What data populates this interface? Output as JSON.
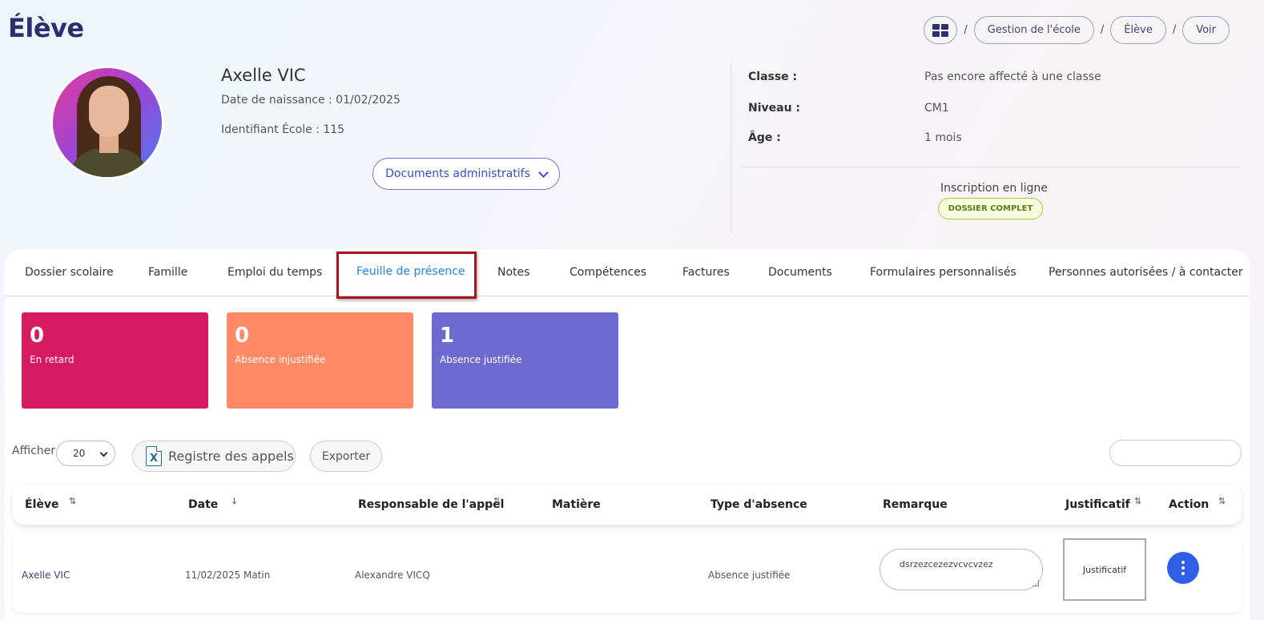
{
  "page": {
    "title": "Élève"
  },
  "breadcrumb": {
    "separator": "/",
    "items": [
      {
        "label": "Gestion de l'école"
      },
      {
        "label": "Élève"
      },
      {
        "label": "Voir"
      }
    ]
  },
  "student": {
    "name": "Axelle VIC",
    "dob": "Date de naissance : 01/02/2025",
    "school_id": "Identifiant École : 115",
    "docs_button": "Documents administratifs"
  },
  "info": {
    "classe_label": "Classe :",
    "classe_value": "Pas encore affecté à une classe",
    "niveau_label": "Niveau :",
    "niveau_value": "CM1",
    "age_label": "Âge :",
    "age_value": "1 mois",
    "online_label": "Inscription en ligne",
    "status_badge": "DOSSIER COMPLET"
  },
  "tabs": [
    {
      "label": "Dossier scolaire"
    },
    {
      "label": "Famille"
    },
    {
      "label": "Emploi du temps"
    },
    {
      "label": "Feuille de présence",
      "active": true
    },
    {
      "label": "Notes"
    },
    {
      "label": "Compétences"
    },
    {
      "label": "Factures"
    },
    {
      "label": "Documents"
    },
    {
      "label": "Formulaires personnalisés"
    },
    {
      "label": "Personnes autorisées / à contacter"
    }
  ],
  "stats": [
    {
      "value": "0",
      "label": "En retard",
      "color": "#d81b60"
    },
    {
      "value": "0",
      "label": "Absence injustifiée",
      "color": "#ff8a65"
    },
    {
      "value": "1",
      "label": "Absence justifiée",
      "color": "#6d6bd0"
    }
  ],
  "toolbar": {
    "afficher_label": "Afficher",
    "page_size": "20",
    "registre_label": "Registre des appels",
    "export_label": "Exporter",
    "search_value": ""
  },
  "table": {
    "columns": [
      {
        "label": "Élève"
      },
      {
        "label": "Date"
      },
      {
        "label": "Responsable de l'appel"
      },
      {
        "label": "Matière"
      },
      {
        "label": "Type d'absence"
      },
      {
        "label": "Remarque"
      },
      {
        "label": "Justificatif"
      },
      {
        "label": "Action"
      }
    ],
    "rows": [
      {
        "eleve": "Axelle VIC",
        "date": "11/02/2025 Matin",
        "responsable": "Alexandre VICQ",
        "matiere": "",
        "type": "Absence justifiée",
        "remarque": "dsrzezcezezvcvcvzez",
        "justificatif": "Justificatif"
      }
    ]
  }
}
